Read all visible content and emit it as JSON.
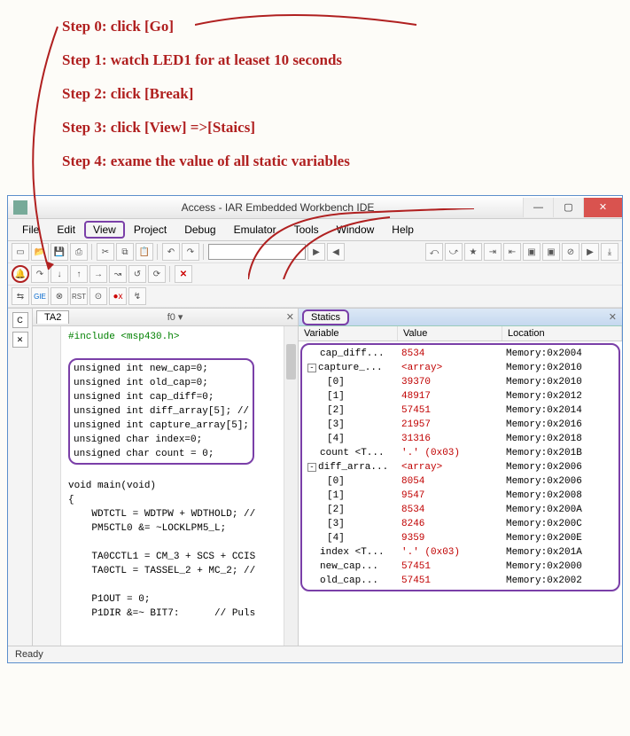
{
  "steps": [
    "Step 0: click [Go]",
    "Step 1:  watch LED1 for at leaset 10 seconds",
    "Step 2: click [Break]",
    "Step 3: click [View] =>[Staics]",
    "Step 4: exame the value of all static variables"
  ],
  "window": {
    "title": "Access - IAR Embedded Workbench IDE",
    "min": "—",
    "max": "▢",
    "close": "✕"
  },
  "menu": [
    "File",
    "Edit",
    "View",
    "Project",
    "Debug",
    "Emulator",
    "Tools",
    "Window",
    "Help"
  ],
  "code": {
    "tab": "TA2",
    "f0": "f0  ▾",
    "include": "#include <msp430.h>",
    "decls": "unsigned int new_cap=0;\nunsigned int old_cap=0;\nunsigned int cap_diff=0;\nunsigned int diff_array[5]; //\nunsigned int capture_array[5];\nunsigned char index=0;\nunsigned char count = 0;",
    "body": "void main(void)\n{\n    WDTCTL = WDTPW + WDTHOLD; //\n    PM5CTL0 &= ~LOCKLPM5_L;\n\n    TA0CCTL1 = CM_3 + SCS + CCIS\n    TA0CTL = TASSEL_2 + MC_2; //\n\n    P1OUT = 0;\n    P1DIR &=~ BIT7:      // Puls"
  },
  "statics": {
    "tab": "Statics",
    "headers": {
      "var": "Variable",
      "val": "Value",
      "loc": "Location"
    },
    "rows": [
      {
        "var": "cap_diff...",
        "val": "8534",
        "loc": "Memory:0x2004",
        "indent": 0
      },
      {
        "var": "capture_...",
        "val": "<array>",
        "loc": "Memory:0x2010",
        "indent": 0,
        "toggle": "-"
      },
      {
        "var": "[0]",
        "val": "39370",
        "loc": "Memory:0x2010",
        "indent": 1
      },
      {
        "var": "[1]",
        "val": "48917",
        "loc": "Memory:0x2012",
        "indent": 1
      },
      {
        "var": "[2]",
        "val": "57451",
        "loc": "Memory:0x2014",
        "indent": 1
      },
      {
        "var": "[3]",
        "val": "21957",
        "loc": "Memory:0x2016",
        "indent": 1
      },
      {
        "var": "[4]",
        "val": "31316",
        "loc": "Memory:0x2018",
        "indent": 1
      },
      {
        "var": "count <T...",
        "val": "'.' (0x03)",
        "loc": "Memory:0x201B",
        "indent": 0
      },
      {
        "var": "diff_arra...",
        "val": "<array>",
        "loc": "Memory:0x2006",
        "indent": 0,
        "toggle": "-"
      },
      {
        "var": "[0]",
        "val": "8054",
        "loc": "Memory:0x2006",
        "indent": 1
      },
      {
        "var": "[1]",
        "val": "9547",
        "loc": "Memory:0x2008",
        "indent": 1
      },
      {
        "var": "[2]",
        "val": "8534",
        "loc": "Memory:0x200A",
        "indent": 1
      },
      {
        "var": "[3]",
        "val": "8246",
        "loc": "Memory:0x200C",
        "indent": 1
      },
      {
        "var": "[4]",
        "val": "9359",
        "loc": "Memory:0x200E",
        "indent": 1
      },
      {
        "var": "index <T...",
        "val": "'.' (0x03)",
        "loc": "Memory:0x201A",
        "indent": 0
      },
      {
        "var": "new_cap...",
        "val": "57451",
        "loc": "Memory:0x2000",
        "indent": 0
      },
      {
        "var": "old_cap...",
        "val": "57451",
        "loc": "Memory:0x2002",
        "indent": 0
      }
    ]
  },
  "status": "Ready"
}
